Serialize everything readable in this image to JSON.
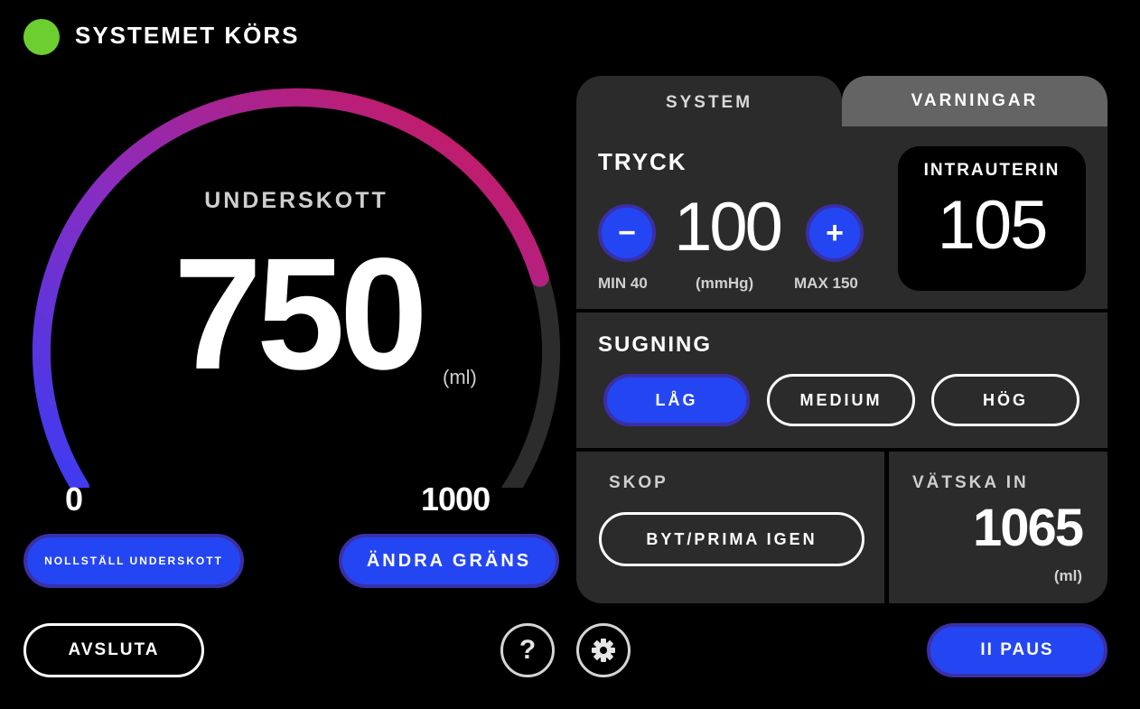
{
  "status": {
    "text": "SYSTEMET KÖRS",
    "color": "#6ccf2f"
  },
  "gauge": {
    "title": "UNDERSKOTT",
    "value": "750",
    "unit": "(ml)",
    "min": "0",
    "max": "1000",
    "fill_fraction": 0.75,
    "gradient_start": "#3a3cf3",
    "gradient_mid": "#8a2cc0",
    "gradient_end": "#d3174f",
    "track_color": "#2c2c2c"
  },
  "buttons": {
    "reset_label": "NOLLSTÄLL UNDERSKOTT",
    "limit_label": "ÄNDRA GRÄNS",
    "exit_label": "AVSLUTA",
    "pause_label": "II PAUS",
    "help_label": "?",
    "settings_icon": "gear-icon"
  },
  "tabs": [
    {
      "label": "SYSTEM",
      "active": true
    },
    {
      "label": "VARNINGAR",
      "active": false
    }
  ],
  "pressure": {
    "title": "TRYCK",
    "value": "100",
    "minus_label": "−",
    "plus_label": "+",
    "min_label": "MIN 40",
    "unit_label": "(mmHg)",
    "max_label": "MAX 150"
  },
  "intrauterine": {
    "label": "INTRAUTERIN",
    "value": "105"
  },
  "suction": {
    "title": "SUGNING",
    "options": [
      "LÅG",
      "MEDIUM",
      "HÖG"
    ],
    "selected": "LÅG"
  },
  "scope": {
    "label": "SKOP",
    "button_label": "BYT/PRIMA IGEN"
  },
  "fluid": {
    "label": "VÄTSKA IN",
    "value": "1065",
    "unit": "(ml)"
  },
  "colors": {
    "accent": "#2446f2",
    "panel": "#2b2b2b",
    "tab_inactive": "#646464"
  }
}
